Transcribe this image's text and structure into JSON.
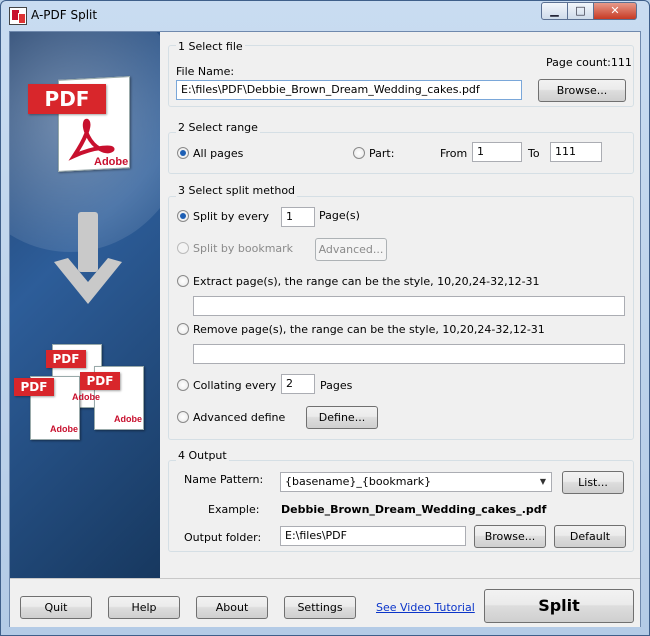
{
  "window": {
    "title": "A-PDF Split",
    "min_glyph": "▁",
    "max_glyph": "□",
    "close_glyph": "✕"
  },
  "sidebar": {
    "pdf_tag": "PDF",
    "adobe_label": "Adobe",
    "small_pdf_tags": [
      "PDF",
      "PDF",
      "PDF"
    ],
    "small_adobe_labels": [
      "Adobe",
      "Adobe",
      "Adobe"
    ]
  },
  "select_file": {
    "section_title": "1 Select file",
    "file_name_label": "File Name:",
    "page_count": "Page count:111",
    "file_path": "E:\\files\\PDF\\Debbie_Brown_Dream_Wedding_cakes.pdf",
    "browse_label": "Browse..."
  },
  "select_range": {
    "section_title": "2 Select range",
    "all_pages_label": "All pages",
    "part_label": "Part:",
    "from_label": "From",
    "from_value": "1",
    "to_label": "To",
    "to_value": "111"
  },
  "split_method": {
    "section_title": "3 Select split method",
    "split_every_label": "Split by every",
    "split_every_value": "1",
    "pages_suffix": "Page(s)",
    "bookmark_label": "Split by bookmark",
    "advanced_label": "Advanced...",
    "extract_label": "Extract page(s), the range can be the style, 10,20,24-32,12-31",
    "extract_value": "",
    "remove_label": "Remove page(s), the range can be the style, 10,20,24-32,12-31",
    "remove_value": "",
    "collating_label": "Collating every",
    "collating_value": "2",
    "collating_suffix": "Pages",
    "advanced_define_label": "Advanced define",
    "define_label": "Define..."
  },
  "output": {
    "section_title": "4 Output",
    "name_pattern_label": "Name Pattern:",
    "name_pattern_value": "{basename}_{bookmark}",
    "list_label": "List...",
    "example_label": "Example:",
    "example_value": "Debbie_Brown_Dream_Wedding_cakes_.pdf",
    "output_folder_label": "Output folder:",
    "output_folder_value": "E:\\files\\PDF",
    "browse_label": "Browse...",
    "default_label": "Default"
  },
  "footer": {
    "quit_label": "Quit",
    "help_label": "Help",
    "about_label": "About",
    "settings_label": "Settings",
    "video_link": "See Video Tutorial",
    "split_label": "Split"
  }
}
